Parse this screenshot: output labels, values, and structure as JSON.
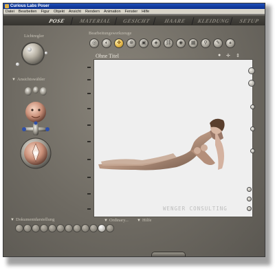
{
  "window": {
    "title": "Curious Labs Poser"
  },
  "menubar": {
    "items": [
      "Datei",
      "Bearbeiten",
      "Figur",
      "Objekt",
      "Ansicht",
      "Rendern",
      "Animation",
      "Fenster",
      "Hilfe"
    ]
  },
  "room_tabs": [
    {
      "label": "POSE",
      "active": true
    },
    {
      "label": "MATERIAL",
      "active": false
    },
    {
      "label": "GESICHT",
      "active": false
    },
    {
      "label": "HAARE",
      "active": false
    },
    {
      "label": "KLEIDUNG",
      "active": false
    },
    {
      "label": "SETUP",
      "active": false
    }
  ],
  "light_panel": {
    "label": "Lichtregler"
  },
  "edit_tools": {
    "label": "Bearbeitungswerkzeuge",
    "buttons": [
      {
        "name": "rotate-tool",
        "icon": "◎",
        "active": false
      },
      {
        "name": "twist-tool",
        "icon": "◐",
        "active": false
      },
      {
        "name": "translate-tool",
        "icon": "✥",
        "active": true
      },
      {
        "name": "translate-in-out-tool",
        "icon": "⊕",
        "active": false
      },
      {
        "name": "scale-tool",
        "icon": "▣",
        "active": false
      },
      {
        "name": "taper-tool",
        "icon": "◈",
        "active": false
      },
      {
        "name": "chain-break-tool",
        "icon": "⛓",
        "active": false
      },
      {
        "name": "color-tool",
        "icon": "◉",
        "active": false
      },
      {
        "name": "grouping-tool",
        "icon": "▦",
        "active": false
      },
      {
        "name": "view-magnifier-tool",
        "icon": "⚲",
        "active": false
      },
      {
        "name": "morph-tool",
        "icon": "✎",
        "active": false
      },
      {
        "name": "direct-manipulation-tool",
        "icon": "⚹",
        "active": false
      }
    ]
  },
  "camera_panel": {
    "label": "Ansichtswähler"
  },
  "document": {
    "title": "Ohne Titel",
    "watermark": "WENGER CONSULTING"
  },
  "display_panel": {
    "label": "Dokumentdarstellung",
    "style_options": [
      "Ordinary...",
      "Hilfe"
    ]
  },
  "colors": {
    "background": "#6b6760",
    "titlebar": "#1f4fb8",
    "active_tool": "#e6b94a",
    "viewport": "#efefef"
  }
}
